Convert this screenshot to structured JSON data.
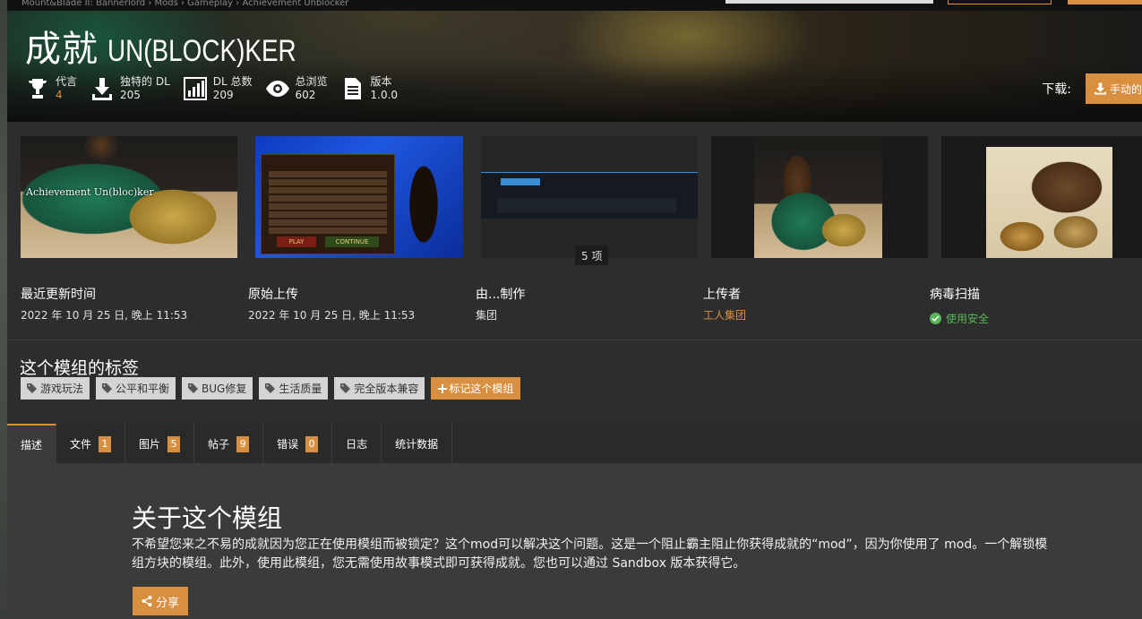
{
  "topbar": {
    "crumb_fragment": "Mount&Blade II: Bannerlord  ›  Mods  ›  Gameplay  ›  Achievement Unblocker"
  },
  "header": {
    "title_cn": "成就",
    "title_en": "UN(BLOCK)KER",
    "stats": [
      {
        "icon": "trophy-icon",
        "label": "代言",
        "value": "4"
      },
      {
        "icon": "download-icon",
        "label": "独特的 DL",
        "value": "205"
      },
      {
        "icon": "bar-chart-icon",
        "label": "DL 总数",
        "value": "209"
      },
      {
        "icon": "eye-icon",
        "label": "总浏览",
        "value": "602"
      },
      {
        "icon": "document-icon",
        "label": "版本",
        "value": "1.0.0"
      }
    ],
    "download_label": "下载:",
    "download_button": "手动的"
  },
  "gallery": {
    "thumb1_caption": "Achievement Un(bloc)ker",
    "game_play": "PLAY",
    "game_continue": "CONTINUE",
    "item_count": "5 项"
  },
  "meta": {
    "last_updated_label": "最近更新时间",
    "last_updated_value": "2022 年 10 月 25 日, 晚上 11:53",
    "original_upload_label": "原始上传",
    "original_upload_value": "2022 年 10 月 25 日, 晚上 11:53",
    "created_by_label": "由...制作",
    "created_by_value": "集团",
    "uploader_label": "上传者",
    "uploader_value": "工人集团",
    "virus_scan_label": "病毒扫描",
    "virus_scan_value": "使用安全"
  },
  "tags": {
    "title": "这个模组的标签",
    "items": [
      "游戏玩法",
      "公平和平衡",
      "BUG修复",
      "生活质量",
      "完全版本兼容"
    ],
    "add_label": "标记这个模组"
  },
  "tabs": [
    {
      "label": "描述",
      "badge": ""
    },
    {
      "label": "文件",
      "badge": "1"
    },
    {
      "label": "图片",
      "badge": "5"
    },
    {
      "label": "帖子",
      "badge": "9"
    },
    {
      "label": "错误",
      "badge": "0"
    },
    {
      "label": "日志",
      "badge": ""
    },
    {
      "label": "统计数据",
      "badge": ""
    }
  ],
  "description": {
    "title": "关于这个模组",
    "text": "不希望您来之不易的成就因为您正在使用模组而被锁定？这个mod可以解决这个问题。这是一个阻止霸主阻止你获得成就的“mod”，因为你使用了 mod。一个解锁模组方块的模组。此外，使用此模组，您无需使用故事模式即可获得成就。您也可以通过 Sandbox 版本获得它。",
    "share_label": "分享"
  },
  "colors": {
    "accent": "#d98f40",
    "safe": "#58b858",
    "page_bg": "#2d2d2d"
  }
}
